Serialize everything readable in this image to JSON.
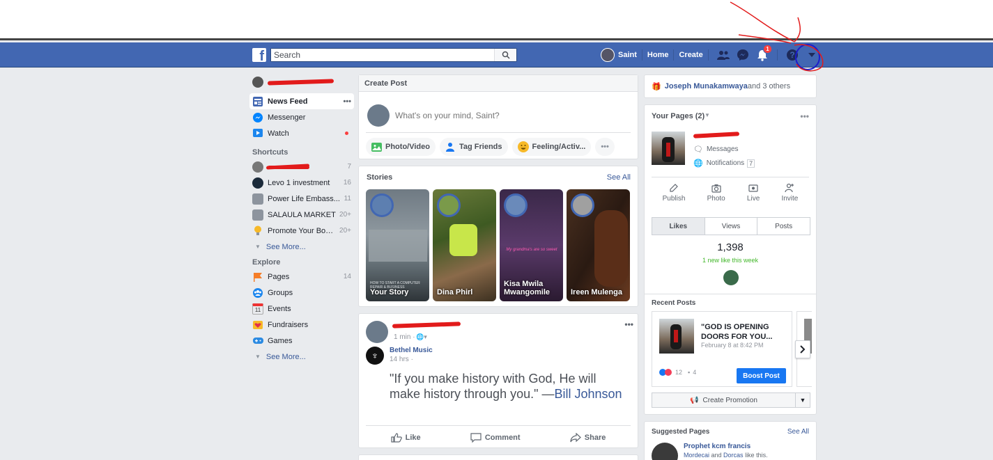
{
  "topbar": {
    "logo": "f",
    "search_placeholder": "Search",
    "user_name": "Saint",
    "home": "Home",
    "create": "Create",
    "notif_count": "1"
  },
  "sidebar": {
    "items": [
      {
        "label": "News Feed",
        "more": "•••"
      },
      {
        "label": "Messenger"
      },
      {
        "label": "Watch"
      }
    ],
    "shortcuts_heading": "Shortcuts",
    "shortcuts": [
      {
        "label": "",
        "count": "7"
      },
      {
        "label": "Levo 1 investment",
        "count": "16"
      },
      {
        "label": "Power Life Embass...",
        "count": "11"
      },
      {
        "label": "SALAULA MARKET",
        "count": "20+"
      },
      {
        "label": "Promote Your Book...",
        "count": "20+"
      }
    ],
    "see_more": "See More...",
    "explore_heading": "Explore",
    "explore": [
      {
        "label": "Pages",
        "count": "14"
      },
      {
        "label": "Groups"
      },
      {
        "label": "Events",
        "icon_text": "11"
      },
      {
        "label": "Fundraisers"
      },
      {
        "label": "Games"
      }
    ],
    "see_more2": "See More..."
  },
  "create_post": {
    "title": "Create Post",
    "placeholder": "What's on your mind, Saint?",
    "photo": "Photo/Video",
    "tag": "Tag Friends",
    "feeling": "Feeling/Activ...",
    "more": "•••"
  },
  "stories": {
    "title": "Stories",
    "see_all": "See All",
    "items": [
      {
        "name": "Your Story",
        "caption": "HOW TO START A COMPUTER REPAIR & BUSINESS"
      },
      {
        "name": "Dina Phirl"
      },
      {
        "name": "Kisa Mwila Mwangomile",
        "caption": "My grandma's are so sweet"
      },
      {
        "name": "Ireen Mulenga"
      }
    ]
  },
  "post": {
    "time": "1 min ·",
    "more": "•••",
    "shared_name": "Bethel Music",
    "shared_time": "14 hrs ·",
    "quote": "\"If you make history with God, He will make history through you.\" —",
    "quote_author": "Bill Johnson",
    "like": "Like",
    "comment": "Comment",
    "share": "Share"
  },
  "right": {
    "invites_name": "Joseph Munakamwaya",
    "invites_rest": " and 3 others",
    "your_pages": "Your Pages (2)",
    "more": "•••",
    "messages": "Messages",
    "notifications": "Notifications",
    "notif_count": "7",
    "actions": [
      "Publish",
      "Photo",
      "Live",
      "Invite"
    ],
    "tabs": [
      "Likes",
      "Views",
      "Posts"
    ],
    "likes_count": "1,398",
    "likes_note": "1 new like this week",
    "recent_posts": "Recent Posts",
    "rp_title": "\"GOD IS OPENING DOORS FOR YOU...",
    "rp_date": "February 8 at 8:42 PM",
    "rp_reacts": "12",
    "rp_comments": "4",
    "boost": "Boost Post",
    "create_promotion": "Create Promotion",
    "suggested": "Suggested Pages",
    "see_all": "See All",
    "sugg_name": "Prophet kcm francis",
    "sugg_friend1": "Mordecai",
    "sugg_and": " and ",
    "sugg_friend2": "Dorcas",
    "sugg_tail": " like this."
  }
}
